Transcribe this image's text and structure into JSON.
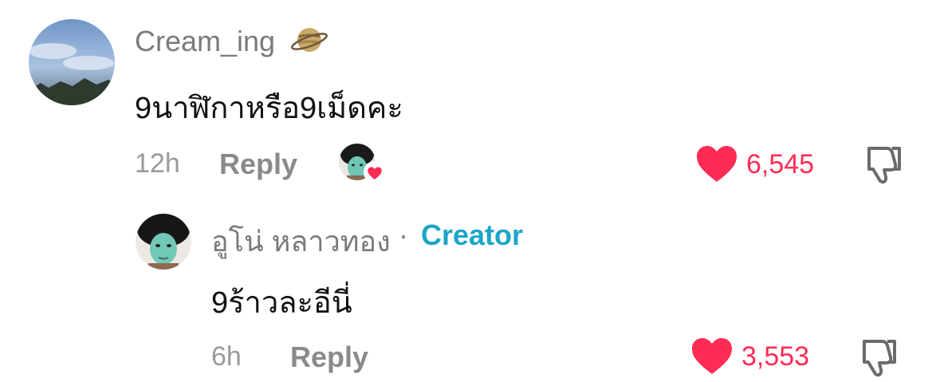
{
  "comments": [
    {
      "username": "Cream_ing",
      "badge_icon": "planet-emoji-icon",
      "text": "9นาฬิกาหรือ9เม็ดคะ",
      "time": "12h",
      "reply_label": "Reply",
      "likes": "6,545",
      "creator_liked": true
    },
    {
      "username": "อูโน่ หลาวทอง",
      "separator": "·",
      "creator_label": "Creator",
      "text": "9ร้าวละอีนี่",
      "time": "6h",
      "reply_label": "Reply",
      "likes": "3,553"
    }
  ],
  "colors": {
    "like": "#fe2c55",
    "creator": "#1aa6c8",
    "secondary_text": "#8a8a8a"
  }
}
